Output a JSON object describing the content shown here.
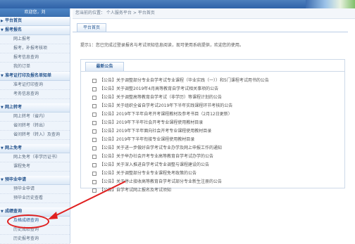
{
  "sidebar": {
    "welcome": "欢迎您，刘",
    "sections": [
      {
        "title": "平台首页",
        "items": []
      },
      {
        "title": "报考报名",
        "items": [
          "网上报考",
          "报考，补报考核项",
          "报考信息查询",
          "我的订单"
        ]
      },
      {
        "title": "准考证打印及报名单知单",
        "items": [
          "准考证打印查询",
          "考务信息查询"
        ]
      },
      {
        "title": "网上转考",
        "items": [
          "网上转考（省内）",
          "省间转考（转出）",
          "省间转考（转入）及查询"
        ]
      },
      {
        "title": "网上免考",
        "items": [
          "网上免考（非学历证书）",
          "课程免考"
        ]
      },
      {
        "title": "预毕业申请",
        "items": [
          "预毕业申请",
          "预毕业历史查看"
        ]
      },
      {
        "title": "成绩查询",
        "items": [
          "及格成绩查询",
          "历史成绩查询",
          "历史报考查询"
        ]
      }
    ]
  },
  "breadcrumb": "您当前的位置： 个人服务平台 > 平台首页",
  "tab_label": "平台首页",
  "notice": "提示1：您已完成过登录报名与考试须知信息阅读，现可使用系统提供，欢迎您的使用。",
  "panel_title": "最新公告",
  "announcements": [
    "【公告】关于调整部分专业自学考试专业课程（毕业实践（一））和5门课程考试用书的公告",
    "【公告】关于调整2019年4月高等教育自学考试相关事项的公告",
    "【公告】关于调整高等教育自学考试（非学历）等课程计划的公告",
    "【公告】关于组织全省自学考试2019年下半年实践课程环节考核的公告",
    "【公告】2019年下半年自考开考课程教材及参考书目（2月12日更新）",
    "【公告】2019年下半年社会开考专业课程使用教材目录",
    "【公告】2019年下半年面向社会开考专业课程使用教材目录",
    "【公告】2019年下半年衔接专业课程使用教材目录",
    "【公告】关于进一步做好自学考试专业办学及网上申报工作的通知",
    "【公告】关于举办社会开考专业高等教育自学考试办学的公告",
    "【公告】关于深入推进自学考试专业调整与课程建设的公告",
    "【公告】关于调整部分专业专业课程免考政策的公告",
    "【公告】关于停止接收高等教育自学考试部分专业新生注册的公告",
    "【公告】自学考试网上报名及考试须知"
  ],
  "colors": {
    "annotation": "#e02020",
    "accent": "#2f62a8"
  }
}
